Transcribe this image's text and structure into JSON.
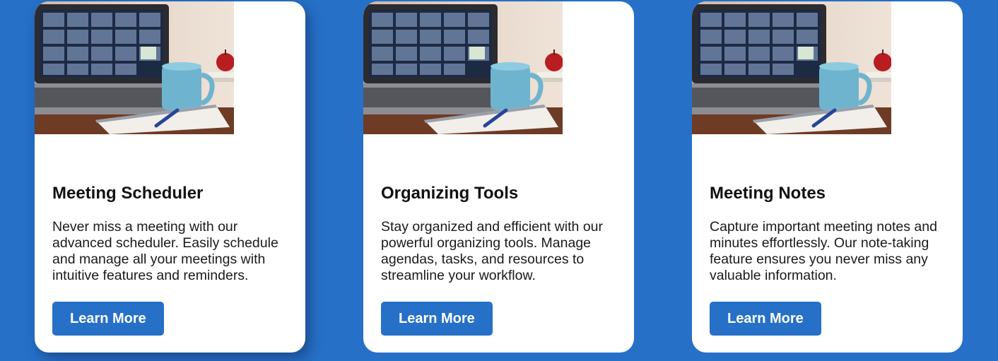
{
  "colors": {
    "background": "#2670c8",
    "card": "#ffffff",
    "button": "#2670c8",
    "button_text": "#ffffff"
  },
  "cards": [
    {
      "image": "laptop-video-call-photo",
      "title": "Meeting Scheduler",
      "description": "Never miss a meeting with our advanced scheduler. Easily schedule and manage all your meetings with intuitive features and reminders.",
      "button_label": "Learn More"
    },
    {
      "image": "laptop-video-call-photo",
      "title": "Organizing Tools",
      "description": "Stay organized and efficient with our powerful organizing tools. Manage agendas, tasks, and resources to streamline your workflow.",
      "button_label": "Learn More"
    },
    {
      "image": "laptop-video-call-photo",
      "title": "Meeting Notes",
      "description": "Capture important meeting notes and minutes effortlessly. Our note-taking feature ensures you never miss any valuable information.",
      "button_label": "Learn More"
    }
  ]
}
